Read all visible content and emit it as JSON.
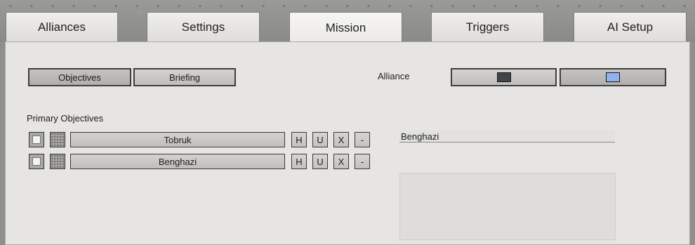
{
  "tabs": [
    {
      "label": "Alliances"
    },
    {
      "label": "Settings"
    },
    {
      "label": "Mission"
    },
    {
      "label": "Triggers"
    },
    {
      "label": "AI Setup"
    }
  ],
  "active_tab": "Mission",
  "mission": {
    "subtabs": [
      {
        "label": "Objectives",
        "selected": true
      },
      {
        "label": "Briefing",
        "selected": false
      }
    ],
    "alliance_label": "Alliance",
    "alliance_colors": [
      "#414449",
      "#8fb2ec"
    ],
    "primary_objectives_label": "Primary Objectives",
    "objectives": [
      {
        "name": "Tobruk",
        "buttons": [
          "H",
          "U",
          "X",
          "-"
        ]
      },
      {
        "name": "Benghazi",
        "buttons": [
          "H",
          "U",
          "X",
          "-"
        ]
      }
    ],
    "selected_objective_name": "Benghazi",
    "description": ""
  }
}
